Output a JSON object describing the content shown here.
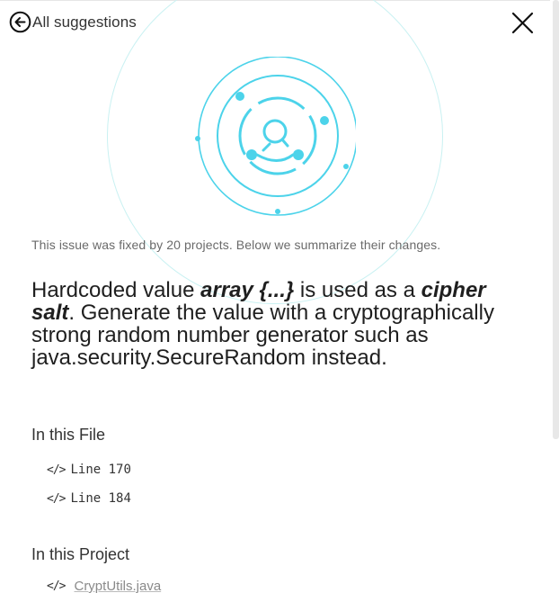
{
  "header": {
    "back_label": "All suggestions",
    "back_icon": "arrow-left-circle-icon",
    "close_icon": "close-icon"
  },
  "summary": {
    "note": "This issue was fixed by 20 projects. Below we summarize their changes."
  },
  "issue": {
    "part1": "Hardcoded value ",
    "value": "array {...}",
    "part2": " is used as a ",
    "target": "cipher salt",
    "part3": ". Generate the value with a cryptographically strong random number generator such as java.security.SecureRandom instead."
  },
  "in_file": {
    "heading": "In this File",
    "items": [
      {
        "icon": "code-icon",
        "label": "Line 170"
      },
      {
        "icon": "code-icon",
        "label": "Line 184"
      }
    ]
  },
  "in_project": {
    "heading": "In this Project",
    "items": [
      {
        "icon": "code-icon",
        "label": "CryptUtils.java"
      }
    ]
  },
  "colors": {
    "accent": "#4cd3ea",
    "faint_ring": "#c9f1f2"
  }
}
